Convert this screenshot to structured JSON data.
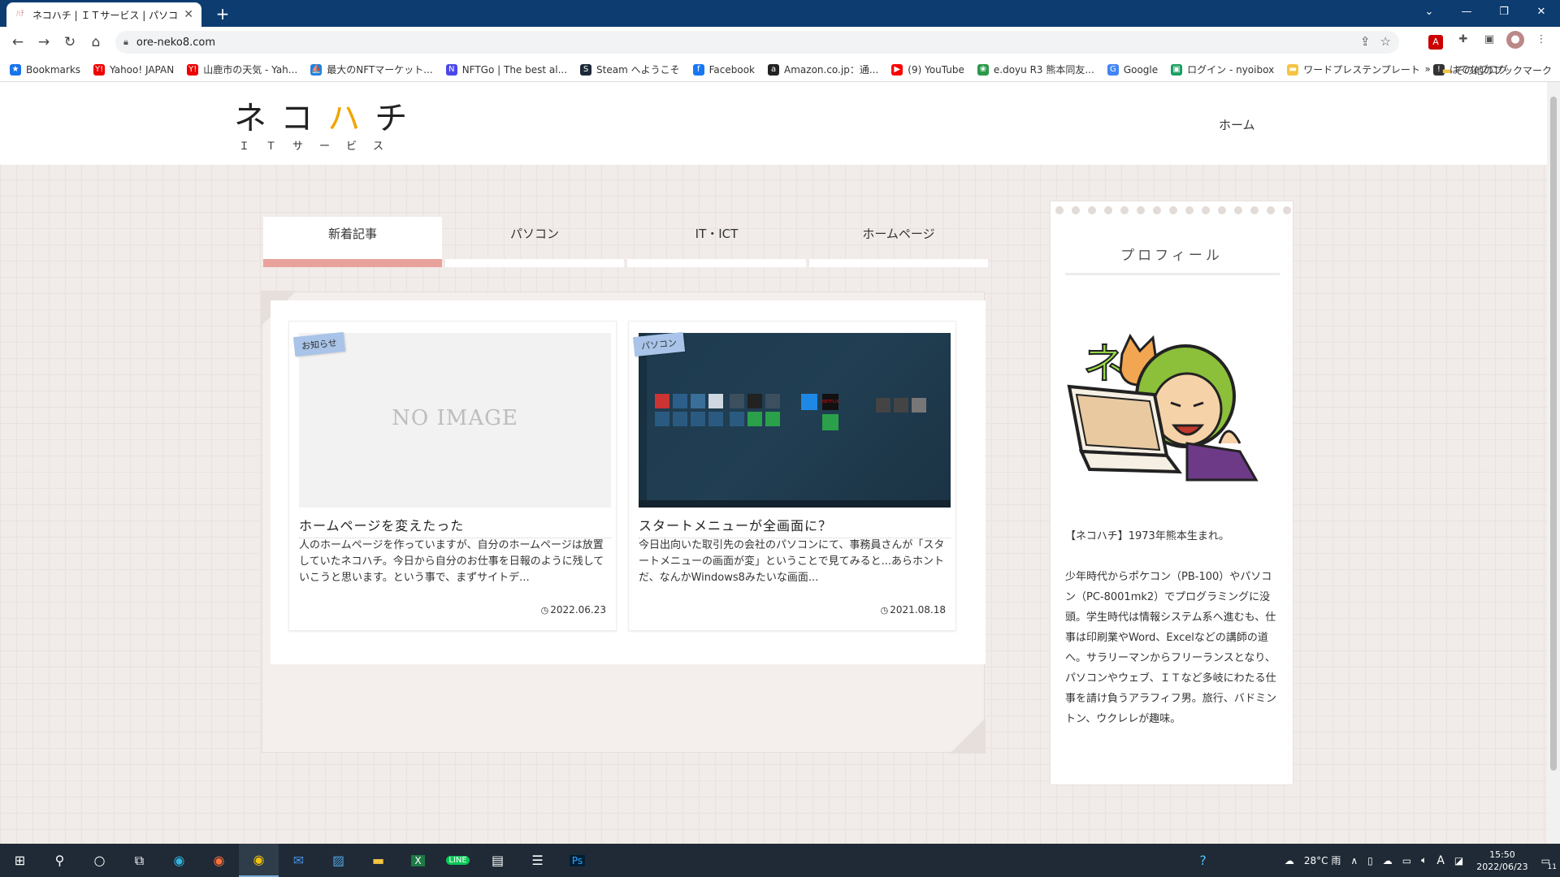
{
  "browser": {
    "tab_title": "ネコハチ | ＩＴサービス | パソコン販売・",
    "tab_close": "✕",
    "new_tab": "+",
    "url": "ore-neko8.com",
    "bookmarks": [
      {
        "label": "Bookmarks",
        "icon": "star-icon",
        "color": "#1a73e8",
        "glyph": "★"
      },
      {
        "label": "Yahoo! JAPAN",
        "icon": "yahoo-icon",
        "color": "#e00",
        "glyph": "Y!"
      },
      {
        "label": "山鹿市の天気 - Yah...",
        "icon": "yahoo-icon",
        "color": "#e00",
        "glyph": "Y!"
      },
      {
        "label": "最大のNFTマーケット...",
        "icon": "opensea-icon",
        "color": "#2081e2",
        "glyph": "⛵"
      },
      {
        "label": "NFTGo | The best al...",
        "icon": "nftgo-icon",
        "color": "#4b48e8",
        "glyph": "N"
      },
      {
        "label": "Steam へようこそ",
        "icon": "steam-icon",
        "color": "#1b2838",
        "glyph": "S"
      },
      {
        "label": "Facebook",
        "icon": "facebook-icon",
        "color": "#1877f2",
        "glyph": "f"
      },
      {
        "label": "Amazon.co.jp：通...",
        "icon": "amazon-icon",
        "color": "#222",
        "glyph": "a"
      },
      {
        "label": "(9) YouTube",
        "icon": "youtube-icon",
        "color": "#f00",
        "glyph": "▶"
      },
      {
        "label": "e.doyu R3 熊本同友...",
        "icon": "edoyu-icon",
        "color": "#2a9a4a",
        "glyph": "❀"
      },
      {
        "label": "Google",
        "icon": "google-icon",
        "color": "#4285f4",
        "glyph": "G"
      },
      {
        "label": "ログイン - nyoibox",
        "icon": "nyoibox-icon",
        "color": "#1a9f60",
        "glyph": "▣"
      },
      {
        "label": "ワードプレステンプレート",
        "icon": "folder-icon",
        "color": "#f4c542",
        "glyph": "▬"
      },
      {
        "label": "はてなブログ",
        "icon": "hatena-icon",
        "color": "#333",
        "glyph": "!"
      }
    ],
    "overflow": "»",
    "other_bookmarks": "その他のブックマーク"
  },
  "site": {
    "logo_pre": "ネコ",
    "logo_accent": "ハ",
    "logo_post": "チ",
    "logo_sub": "ＩＴサービス",
    "nav_home": "ホーム",
    "accent_color": "#f0a500"
  },
  "tabs": [
    {
      "label": "新着記事",
      "active": true
    },
    {
      "label": "パソコン",
      "active": false
    },
    {
      "label": "IT・ICT",
      "active": false
    },
    {
      "label": "ホームページ",
      "active": false
    }
  ],
  "cards": [
    {
      "category": "お知らせ",
      "no_image": "NO IMAGE",
      "title": "ホームページを変えたった",
      "excerpt": "人のホームページを作っていますが、自分のホームページは放置していたネコハチ。今日から自分のお仕事を日報のように残していこうと思います。という事で、まずサイトデ...",
      "date": "2022.06.23"
    },
    {
      "category": "パソコン",
      "title": "スタートメニューが全画面に？",
      "excerpt": "今日出向いた取引先の会社のパソコンにて、事務員さんが「スタートメニューの画面が変」ということで見てみると...あらホントだ、なんかWindows8みたいな画面...",
      "date": "2021.08.18"
    }
  ],
  "profile": {
    "heading": "プロフィール",
    "intro": "【ネコハチ】1973年熊本生まれ。",
    "bio": "少年時代からポケコン（PB-100）やパソコン（PC-8001mk2）でプログラミングに没頭。学生時代は情報システム系へ進むも、仕事は印刷業やWord、Excelなどの講師の道へ。サラリーマンからフリーランスとなり、パソコンやウェブ、ＩＴなど多岐にわたる仕事を請け負うアラフィフ男。旅行、バドミントン、ウクレレが趣味。"
  },
  "taskbar": {
    "weather": "28°C 雨",
    "ime": "A",
    "time": "15:50",
    "date": "2022/06/23",
    "notifications": "11"
  }
}
